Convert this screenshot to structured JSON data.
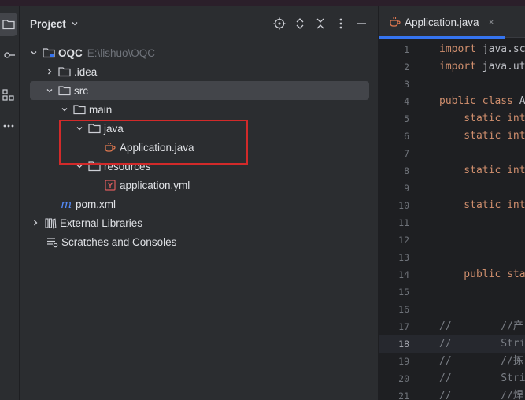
{
  "panel": {
    "title": "Project",
    "actions": [
      "locate-icon",
      "expand-collapse-icon",
      "collapse-all-icon",
      "more-vertical-icon",
      "minimize-icon"
    ]
  },
  "tree": [
    {
      "label": "OQC",
      "path": "E:\\lishuo\\OQC",
      "icon": "module-folder-icon",
      "expanded": true,
      "depth": 0
    },
    {
      "label": ".idea",
      "icon": "folder-icon",
      "expanded": false,
      "depth": 1
    },
    {
      "label": "src",
      "icon": "folder-icon",
      "expanded": true,
      "depth": 1,
      "selected": true
    },
    {
      "label": "main",
      "icon": "folder-icon",
      "expanded": true,
      "depth": 2
    },
    {
      "label": "java",
      "icon": "source-folder-icon",
      "expanded": true,
      "depth": 3
    },
    {
      "label": "Application.java",
      "icon": "java-class-icon",
      "depth": 4
    },
    {
      "label": "resources",
      "icon": "resources-folder-icon",
      "expanded": true,
      "depth": 3
    },
    {
      "label": "application.yml",
      "icon": "yaml-file-icon",
      "depth": 4
    },
    {
      "label": "pom.xml",
      "icon": "maven-icon",
      "depth": 1
    },
    {
      "label": "External Libraries",
      "icon": "library-icon",
      "expanded": false,
      "depth": 0
    },
    {
      "label": "Scratches and Consoles",
      "icon": "scratches-icon",
      "depth": 0
    }
  ],
  "editor": {
    "tab": {
      "label": "Application.java",
      "close": "×"
    },
    "current_line": "18",
    "lines": [
      {
        "n": "1",
        "parts": [
          {
            "t": "import",
            "c": "kw"
          },
          {
            "t": " java.sc",
            "c": ""
          }
        ]
      },
      {
        "n": "2",
        "parts": [
          {
            "t": "import",
            "c": "kw"
          },
          {
            "t": " java.ut",
            "c": ""
          }
        ]
      },
      {
        "n": "3",
        "parts": []
      },
      {
        "n": "4",
        "parts": [
          {
            "t": "public class",
            "c": "kw"
          },
          {
            "t": " A",
            "c": ""
          }
        ]
      },
      {
        "n": "5",
        "parts": [
          {
            "t": "    static int",
            "c": "kw"
          }
        ]
      },
      {
        "n": "6",
        "parts": [
          {
            "t": "    static int",
            "c": "kw"
          }
        ]
      },
      {
        "n": "7",
        "parts": []
      },
      {
        "n": "8",
        "parts": [
          {
            "t": "    static int",
            "c": "kw"
          }
        ]
      },
      {
        "n": "9",
        "parts": []
      },
      {
        "n": "10",
        "parts": [
          {
            "t": "    static int",
            "c": "kw"
          }
        ]
      },
      {
        "n": "11",
        "parts": []
      },
      {
        "n": "12",
        "parts": []
      },
      {
        "n": "13",
        "parts": []
      },
      {
        "n": "14",
        "parts": [
          {
            "t": "    public sta",
            "c": "kw"
          }
        ]
      },
      {
        "n": "15",
        "parts": []
      },
      {
        "n": "16",
        "parts": []
      },
      {
        "n": "17",
        "parts": [
          {
            "t": "//        //产",
            "c": "cm"
          }
        ]
      },
      {
        "n": "18",
        "parts": [
          {
            "t": "//        Stri",
            "c": "cm"
          }
        ]
      },
      {
        "n": "19",
        "parts": [
          {
            "t": "//        //拣",
            "c": "cm"
          }
        ]
      },
      {
        "n": "20",
        "parts": [
          {
            "t": "//        Stri",
            "c": "cm"
          }
        ]
      },
      {
        "n": "21",
        "parts": [
          {
            "t": "//        //焊",
            "c": "cm"
          }
        ]
      }
    ]
  },
  "colors": {
    "accent": "#3574f0",
    "highlight_box": "#d22a2a",
    "keyword": "#cf8e6d",
    "comment": "#7a7e85"
  }
}
